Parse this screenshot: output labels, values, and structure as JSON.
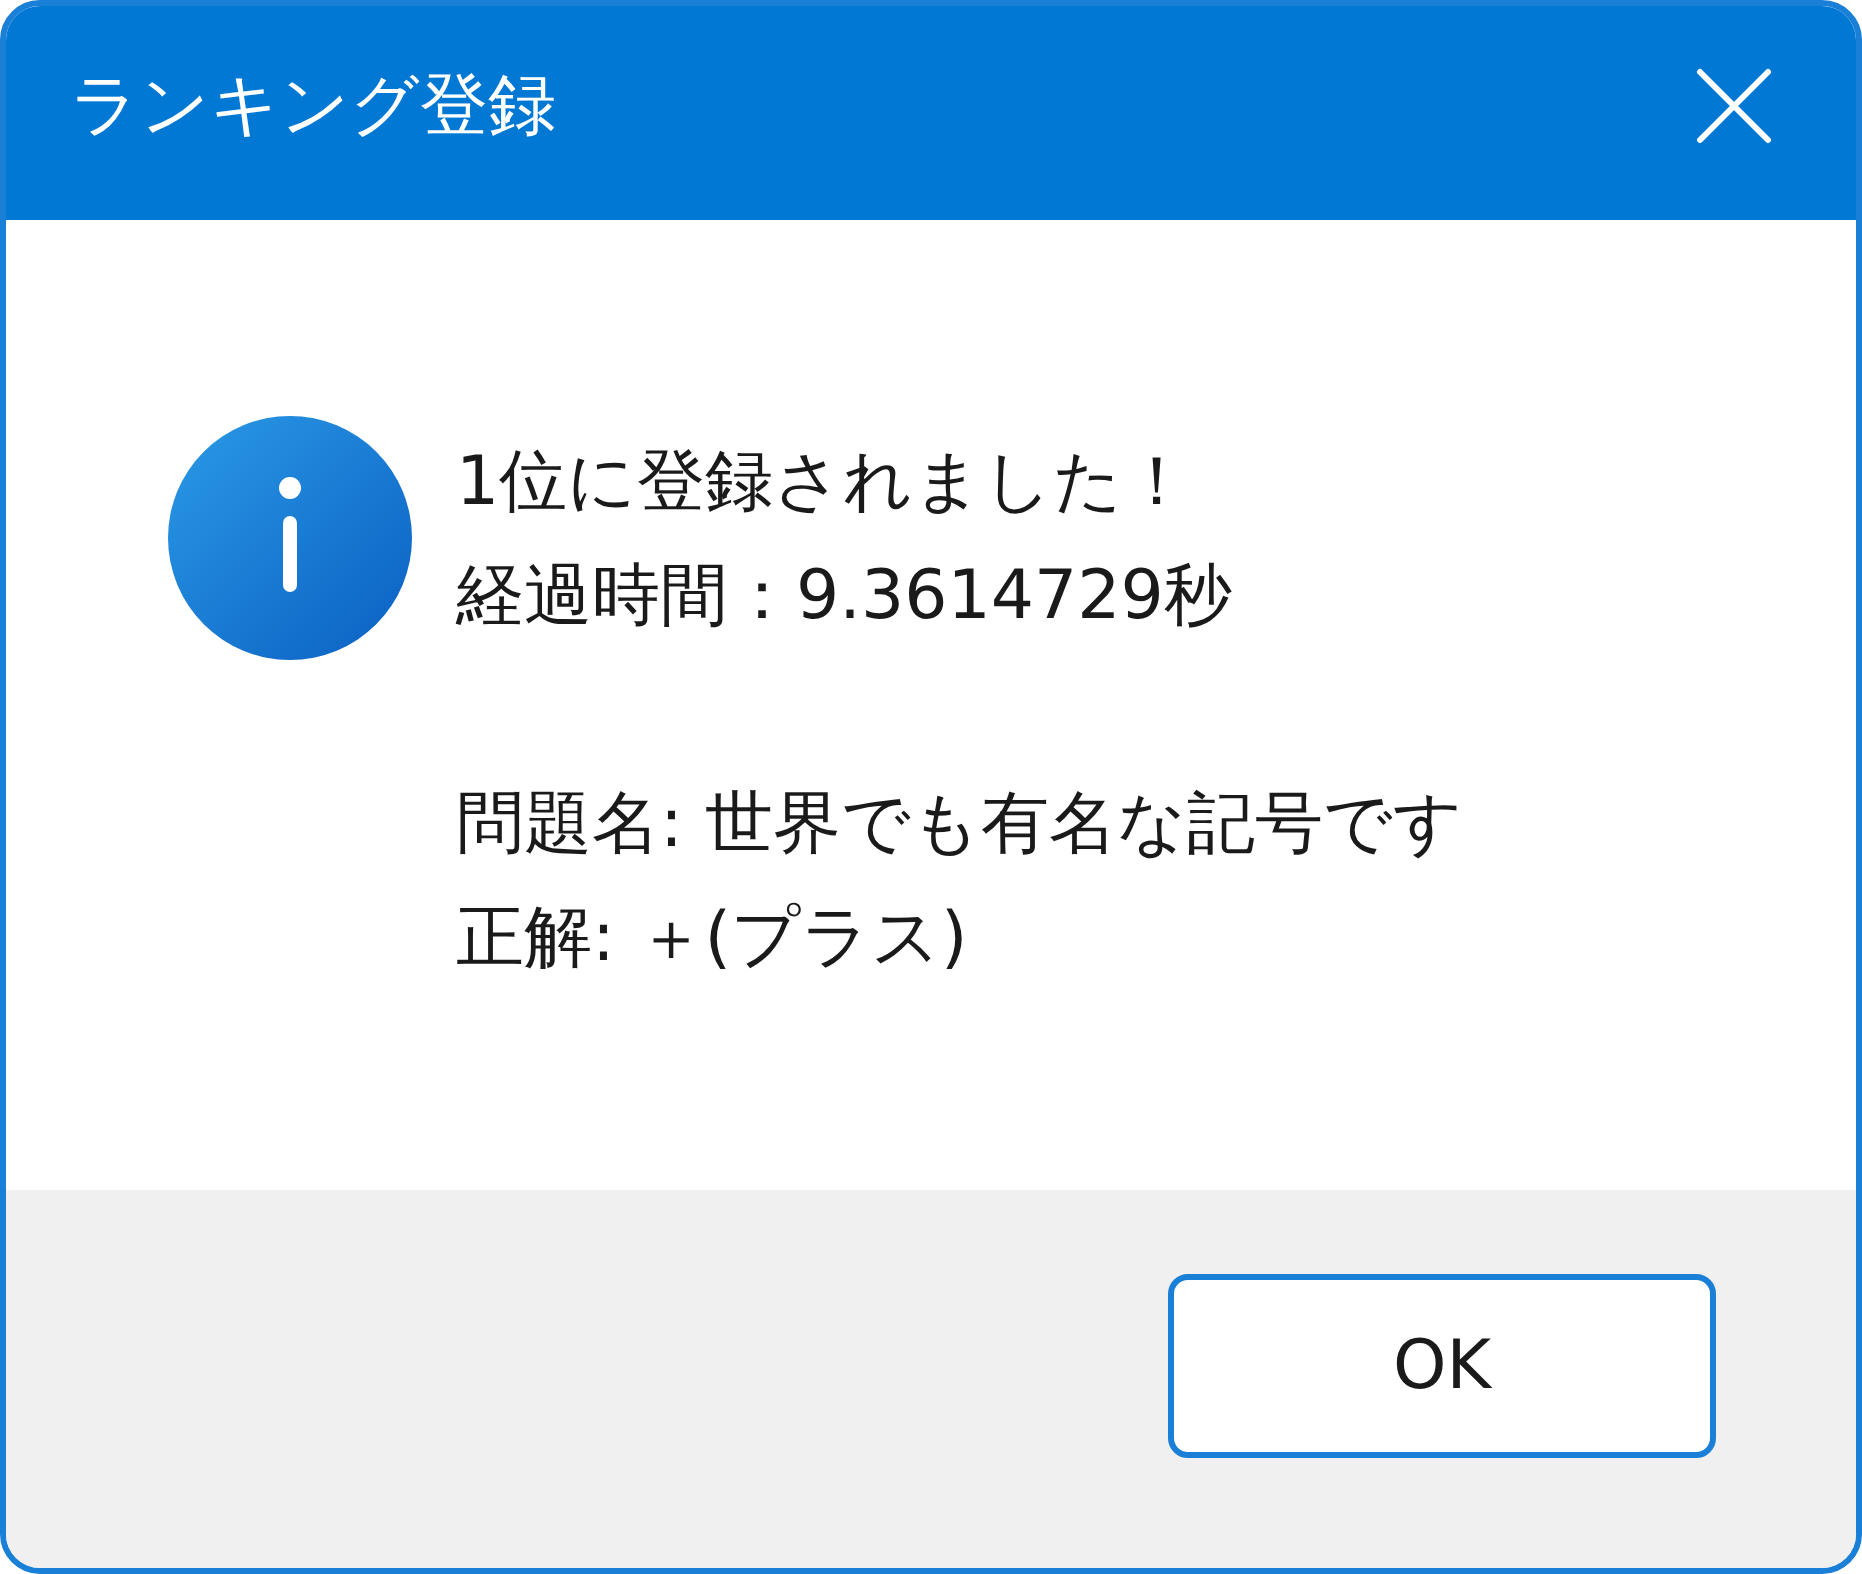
{
  "window": {
    "title": "ランキング登録"
  },
  "message": {
    "paragraphs": [
      [
        "1位に登録されました！",
        "経過時間：9.3614729秒"
      ],
      [
        "問題名: 世界でも有名な記号です",
        "正解: ＋(プラス)"
      ]
    ]
  },
  "buttons": [
    {
      "label": "OK",
      "default": true
    }
  ]
}
